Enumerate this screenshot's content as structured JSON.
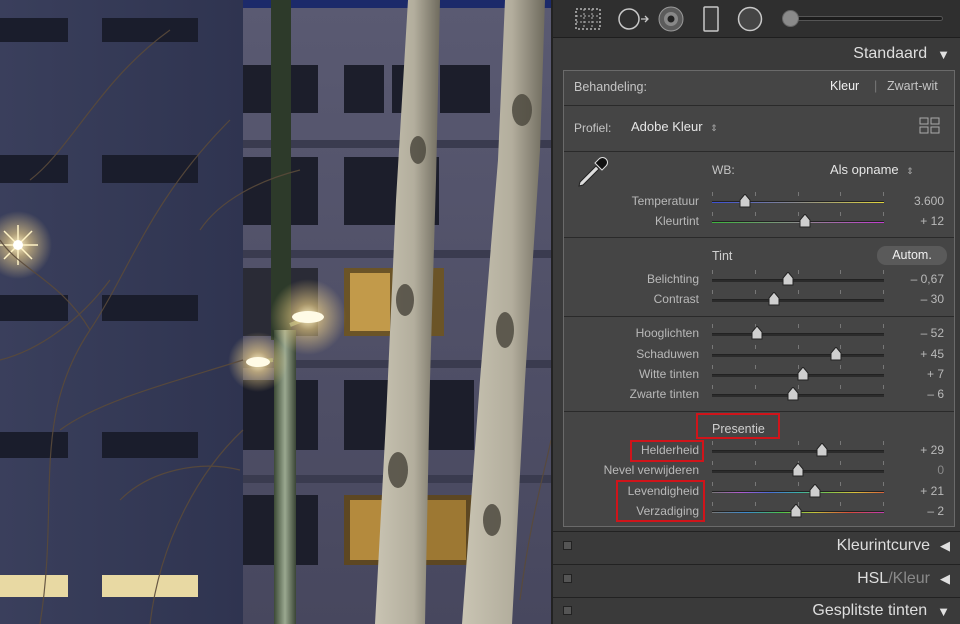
{
  "panel": {
    "header_standard": "Standaard",
    "treatment": {
      "label": "Behandeling:",
      "color": "Kleur",
      "separator": "|",
      "bw": "Zwart-wit"
    },
    "profile": {
      "label": "Profiel:",
      "value": "Adobe Kleur",
      "chevron": "⌃⌄"
    },
    "wb": {
      "label": "WB:",
      "value": "Als opname"
    },
    "tone_header": "Tint",
    "auto_button": "Autom.",
    "presence_header": "Presentie",
    "sliders": [
      {
        "id": "temperatuur",
        "label": "Temperatuur",
        "value": "3.600",
        "position": 0.19,
        "gradient": "temp"
      },
      {
        "id": "kleurtint",
        "label": "Kleurtint",
        "value": "+ 12",
        "position": 0.54,
        "gradient": "tint"
      },
      {
        "id": "belichting",
        "label": "Belichting",
        "value": "– 0,67",
        "position": 0.44,
        "gradient": "none"
      },
      {
        "id": "contrast",
        "label": "Contrast",
        "value": "– 30",
        "position": 0.36,
        "gradient": "none"
      },
      {
        "id": "hooglichten",
        "label": "Hooglichten",
        "value": "– 52",
        "position": 0.26,
        "gradient": "none"
      },
      {
        "id": "schaduwen",
        "label": "Schaduwen",
        "value": "+ 45",
        "position": 0.72,
        "gradient": "none"
      },
      {
        "id": "witte-tinten",
        "label": "Witte tinten",
        "value": "+ 7",
        "position": 0.53,
        "gradient": "none"
      },
      {
        "id": "zwarte-tinten",
        "label": "Zwarte tinten",
        "value": "– 6",
        "position": 0.47,
        "gradient": "none"
      },
      {
        "id": "helderheid",
        "label": "Helderheid",
        "value": "+ 29",
        "position": 0.64,
        "gradient": "none"
      },
      {
        "id": "nevel",
        "label": "Nevel verwijderen",
        "value": "0",
        "position": 0.5,
        "gradient": "none"
      },
      {
        "id": "levendigheid",
        "label": "Levendigheid",
        "value": "+ 21",
        "position": 0.6,
        "gradient": "vibrance"
      },
      {
        "id": "verzadiging",
        "label": "Verzadiging",
        "value": "– 2",
        "position": 0.49,
        "gradient": "saturation"
      }
    ],
    "collapsed_sections": [
      {
        "id": "tone-curve",
        "title": "Kleurintcurve",
        "arrow": "◀"
      },
      {
        "id": "hsl",
        "title_main": "HSL",
        "sep": " / ",
        "title_sub": "Kleur",
        "arrow": "◀"
      },
      {
        "id": "split-toning",
        "title": "Gesplitste tinten",
        "arrow": "▼"
      }
    ],
    "header_arrow": "▼"
  },
  "colors": {
    "highlight_box": "#d0141a",
    "panel_bg": "#3a3a3a",
    "section_bg": "#454545"
  },
  "icons": [
    "grid-crop-icon",
    "spot-removal-icon",
    "red-eye-icon",
    "graduated-filter-icon",
    "radial-filter-icon",
    "brush-icon",
    "eyedropper-icon",
    "profile-browser-icon"
  ]
}
